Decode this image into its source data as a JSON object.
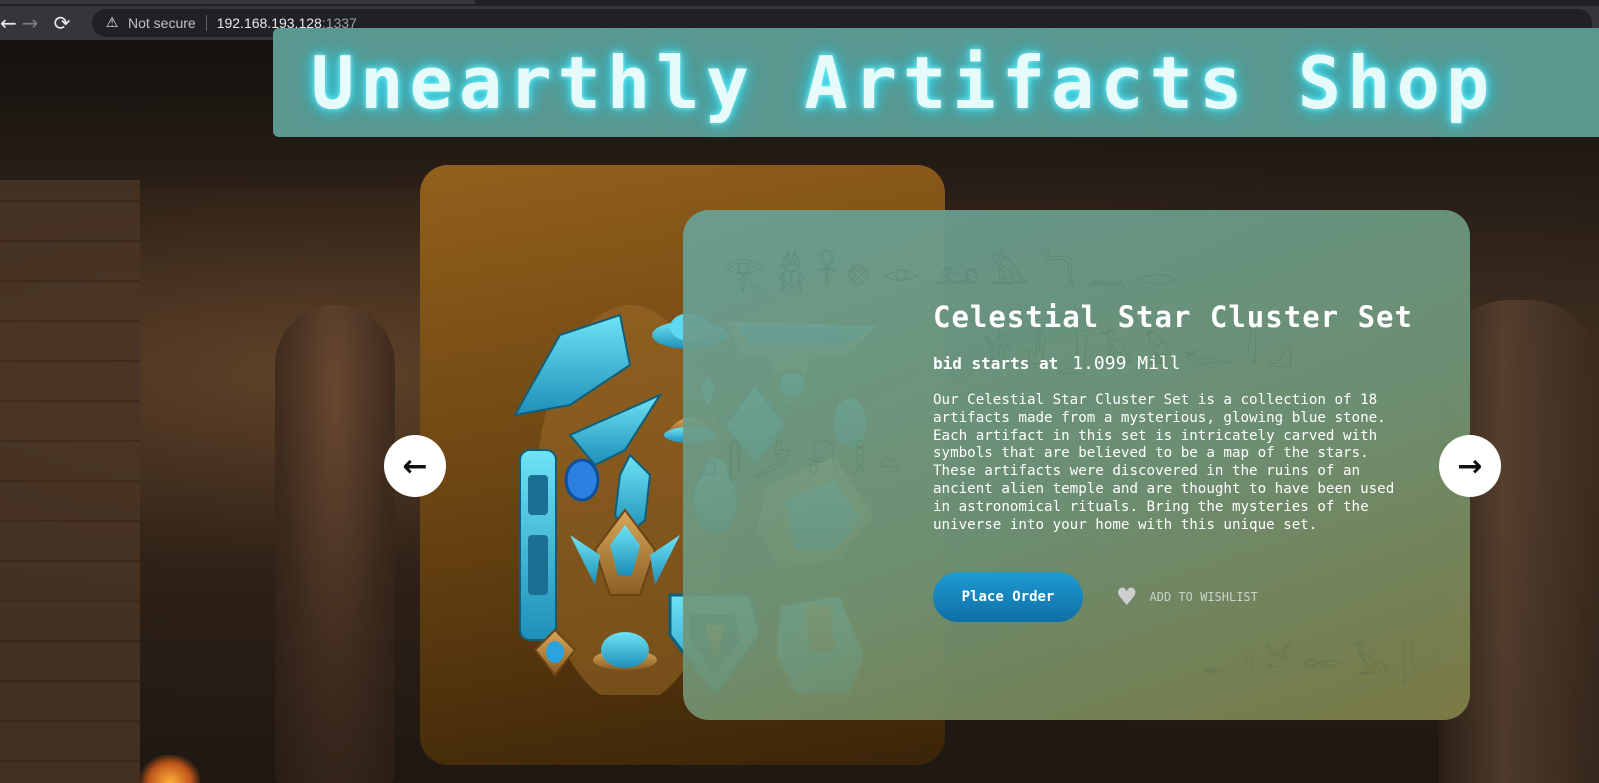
{
  "browser": {
    "back_icon": "←",
    "forward_icon": "→",
    "reload_icon": "⟳",
    "security_icon": "⚠",
    "security_label": "Not secure",
    "url_host": "192.168.193.128",
    "url_port": ":1337"
  },
  "header": {
    "title": "Unearthly Artifacts Shop"
  },
  "product": {
    "title": "Celestial Star Cluster Set",
    "bid_label": "bid starts at",
    "bid_value": "1.099 Mill",
    "description": "Our Celestial Star Cluster Set is a collection of 18 artifacts made from a mysterious, glowing blue stone. Each artifact in this set is intricately carved with symbols that are believed to be a map of the stars. These artifacts were discovered in the ruins of an ancient alien temple and are thought to have been used in astronomical rituals. Bring the mysteries of the universe into your home with this unique set.",
    "order_button": "Place Order",
    "wishlist_label": "ADD TO WISHLIST"
  },
  "carousel": {
    "prev_icon": "←",
    "next_icon": "→"
  },
  "colors": {
    "banner": "#5a9890",
    "glow": "#37d9ee",
    "order_button": "#1486bd",
    "back_card": "#7a5016"
  },
  "icons": {
    "back": "arrow-left-icon",
    "forward": "arrow-right-icon",
    "reload": "reload-icon",
    "security": "warning-triangle-icon",
    "wishlist": "heart-icon",
    "carousel_prev": "arrow-left-icon",
    "carousel_next": "arrow-right-icon"
  }
}
